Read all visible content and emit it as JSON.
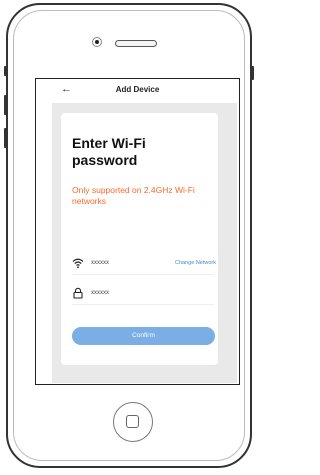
{
  "nav": {
    "back_icon": "back-arrow-icon",
    "back_glyph": "←",
    "title": "Add Device"
  },
  "form": {
    "heading": "Enter Wi-Fi password",
    "note": "Only supported on 2.4GHz Wi-Fi networks",
    "network": {
      "icon": "wifi-icon",
      "value": "xxxxxx",
      "action": "Change Network"
    },
    "password": {
      "icon": "lock-icon",
      "value": "xxxxxx"
    },
    "confirm_label": "Confirm"
  },
  "colors": {
    "accent": "#4a86d9",
    "button": "#7aaee4",
    "warning": "#ff6a2c",
    "panel": "#e9e9e9"
  }
}
